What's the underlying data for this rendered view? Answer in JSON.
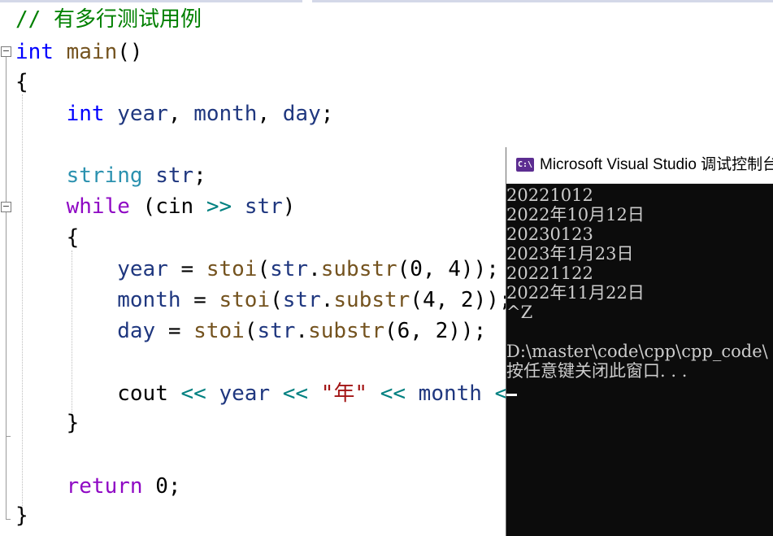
{
  "editor": {
    "lines": [
      [
        {
          "t": "// 有多行测试用例",
          "c": "cm"
        }
      ],
      [
        {
          "t": "int",
          "c": "kw"
        },
        {
          "t": " ",
          "c": ""
        },
        {
          "t": "main",
          "c": "fn"
        },
        {
          "t": "()",
          "c": ""
        }
      ],
      [
        {
          "t": "{",
          "c": ""
        }
      ],
      [
        {
          "t": "    ",
          "c": ""
        },
        {
          "t": "int",
          "c": "kw"
        },
        {
          "t": " ",
          "c": ""
        },
        {
          "t": "year",
          "c": "id"
        },
        {
          "t": ", ",
          "c": ""
        },
        {
          "t": "month",
          "c": "id"
        },
        {
          "t": ", ",
          "c": ""
        },
        {
          "t": "day",
          "c": "id"
        },
        {
          "t": ";",
          "c": ""
        }
      ],
      [
        {
          "t": "",
          "c": ""
        }
      ],
      [
        {
          "t": "    ",
          "c": ""
        },
        {
          "t": "string",
          "c": "type"
        },
        {
          "t": " ",
          "c": ""
        },
        {
          "t": "str",
          "c": "id"
        },
        {
          "t": ";",
          "c": ""
        }
      ],
      [
        {
          "t": "    ",
          "c": ""
        },
        {
          "t": "while",
          "c": "ctl"
        },
        {
          "t": " (",
          "c": ""
        },
        {
          "t": "cin",
          "c": ""
        },
        {
          "t": " ",
          "c": ""
        },
        {
          "t": ">>",
          "c": "op"
        },
        {
          "t": " ",
          "c": ""
        },
        {
          "t": "str",
          "c": "id"
        },
        {
          "t": ")",
          "c": ""
        }
      ],
      [
        {
          "t": "    {",
          "c": ""
        }
      ],
      [
        {
          "t": "        ",
          "c": ""
        },
        {
          "t": "year",
          "c": "id"
        },
        {
          "t": " = ",
          "c": ""
        },
        {
          "t": "stoi",
          "c": "fn"
        },
        {
          "t": "(",
          "c": ""
        },
        {
          "t": "str",
          "c": "id"
        },
        {
          "t": ".",
          "c": ""
        },
        {
          "t": "substr",
          "c": "fn"
        },
        {
          "t": "(0, 4));",
          "c": ""
        }
      ],
      [
        {
          "t": "        ",
          "c": ""
        },
        {
          "t": "month",
          "c": "id"
        },
        {
          "t": " = ",
          "c": ""
        },
        {
          "t": "stoi",
          "c": "fn"
        },
        {
          "t": "(",
          "c": ""
        },
        {
          "t": "str",
          "c": "id"
        },
        {
          "t": ".",
          "c": ""
        },
        {
          "t": "substr",
          "c": "fn"
        },
        {
          "t": "(4, 2));",
          "c": ""
        }
      ],
      [
        {
          "t": "        ",
          "c": ""
        },
        {
          "t": "day",
          "c": "id"
        },
        {
          "t": " = ",
          "c": ""
        },
        {
          "t": "stoi",
          "c": "fn"
        },
        {
          "t": "(",
          "c": ""
        },
        {
          "t": "str",
          "c": "id"
        },
        {
          "t": ".",
          "c": ""
        },
        {
          "t": "substr",
          "c": "fn"
        },
        {
          "t": "(6, 2));",
          "c": ""
        }
      ],
      [
        {
          "t": "",
          "c": ""
        }
      ],
      [
        {
          "t": "        ",
          "c": ""
        },
        {
          "t": "cout",
          "c": ""
        },
        {
          "t": " ",
          "c": ""
        },
        {
          "t": "<<",
          "c": "op"
        },
        {
          "t": " ",
          "c": ""
        },
        {
          "t": "year",
          "c": "id"
        },
        {
          "t": " ",
          "c": ""
        },
        {
          "t": "<<",
          "c": "op"
        },
        {
          "t": " ",
          "c": ""
        },
        {
          "t": "\"年\"",
          "c": "str"
        },
        {
          "t": " ",
          "c": ""
        },
        {
          "t": "<<",
          "c": "op"
        },
        {
          "t": " ",
          "c": ""
        },
        {
          "t": "month",
          "c": "id"
        },
        {
          "t": " ",
          "c": ""
        },
        {
          "t": "<<",
          "c": "op"
        }
      ],
      [
        {
          "t": "    }",
          "c": ""
        }
      ],
      [
        {
          "t": "",
          "c": ""
        }
      ],
      [
        {
          "t": "    ",
          "c": ""
        },
        {
          "t": "return",
          "c": "ctl"
        },
        {
          "t": " 0;",
          "c": ""
        }
      ],
      [
        {
          "t": "}",
          "c": ""
        }
      ]
    ],
    "fold_markers": [
      "−",
      "−"
    ]
  },
  "console": {
    "title": "Microsoft Visual Studio 调试控制台",
    "icon": "C:\\",
    "icon_name": "vs-console-icon",
    "output_lines": [
      "20221012",
      "2022年10月12日",
      "20230123",
      "2023年1月23日",
      "20221122",
      "2022年11月22日",
      "^Z",
      "",
      "D:\\master\\code\\cpp\\cpp_code\\",
      "按任意键关闭此窗口. . ."
    ]
  }
}
